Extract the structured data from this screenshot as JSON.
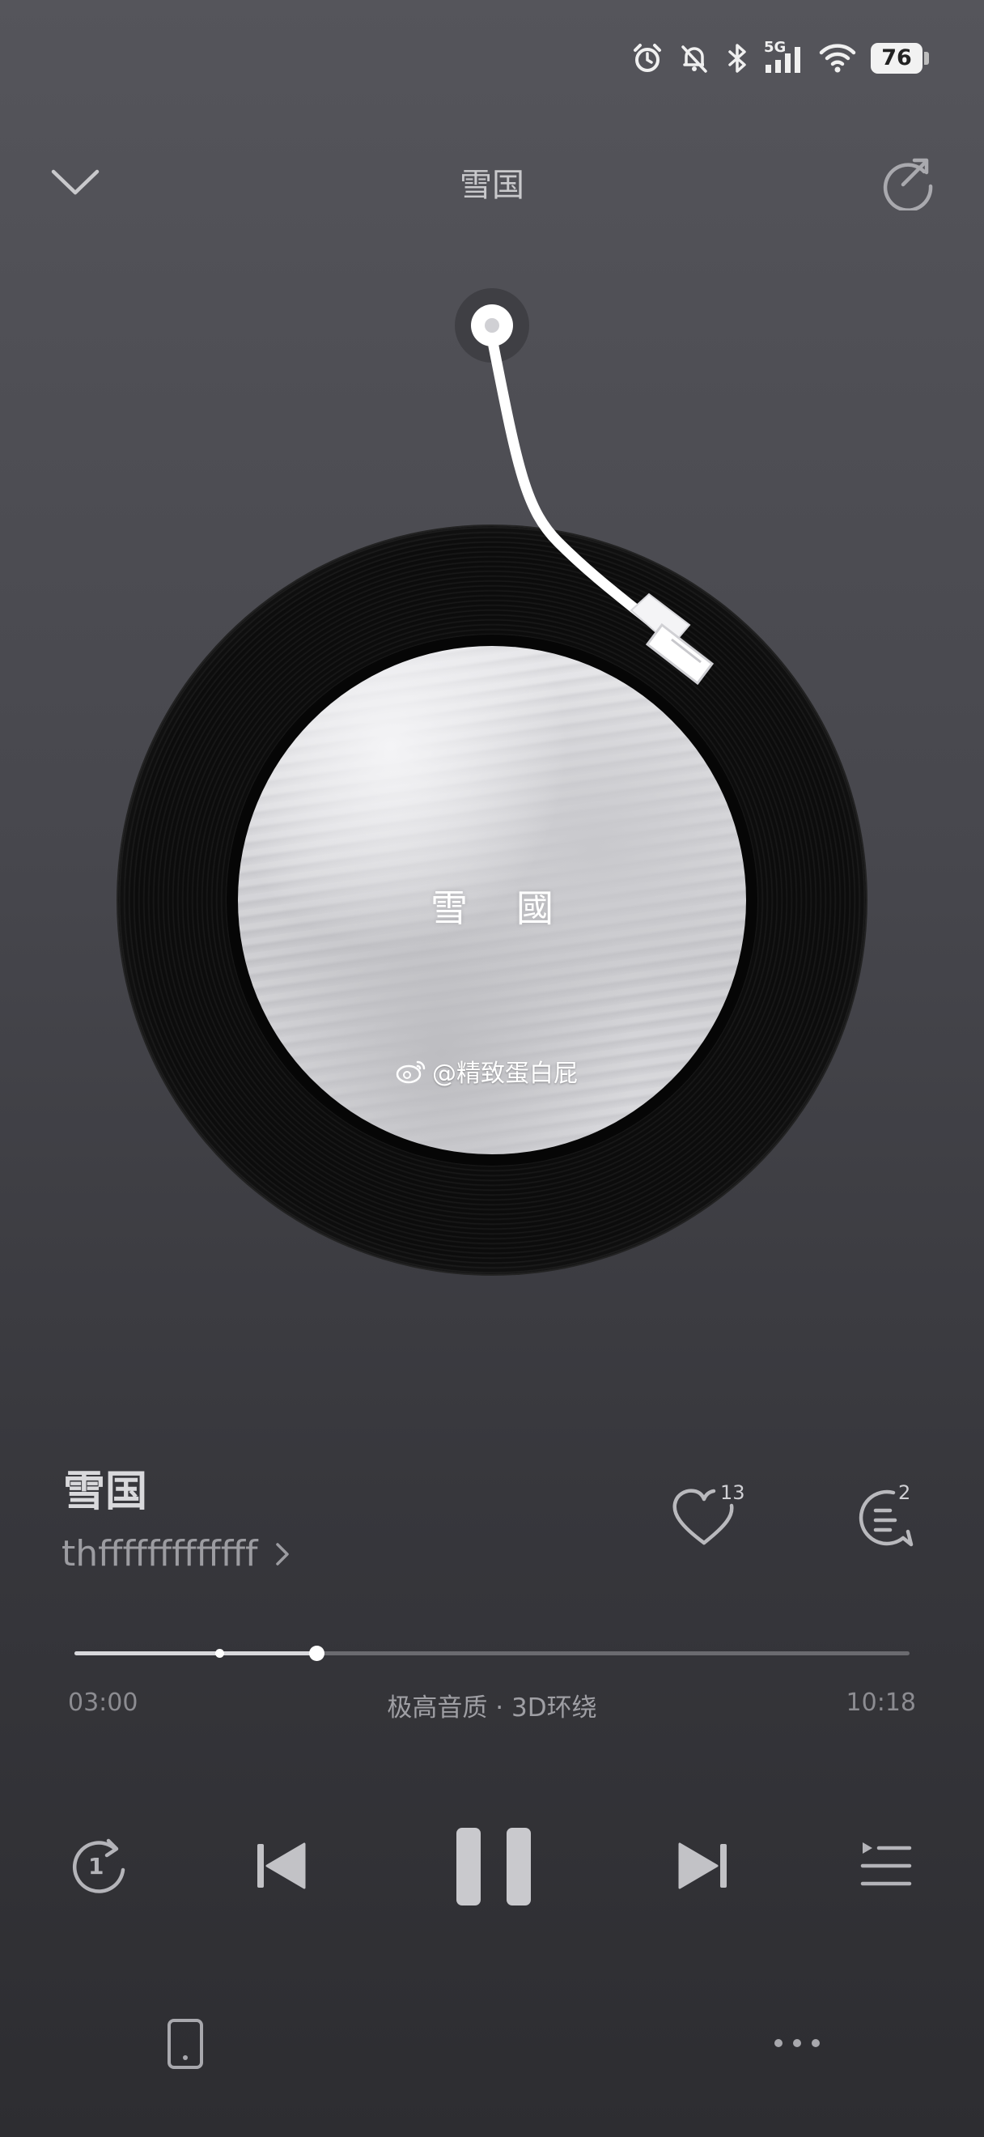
{
  "status_bar": {
    "battery": "76",
    "network": "5G",
    "icons": [
      "alarm-icon",
      "mute-icon",
      "bluetooth-icon",
      "signal-icon",
      "wifi-icon",
      "battery-icon"
    ]
  },
  "header": {
    "title": "雪国",
    "collapse_icon": "chevron-down-icon",
    "share_icon": "share-icon"
  },
  "album": {
    "cover_text": "雪國",
    "watermark": "@精致蛋白屁"
  },
  "song": {
    "title": "雪国",
    "artist": "thfffffffffffff",
    "likes": "13",
    "comments": "2"
  },
  "player": {
    "current_time": "03:00",
    "total_time": "10:18",
    "quality": "极高音质 · 3D环绕",
    "progress": 0.29,
    "buffered": 0.173,
    "repeat_mode": "1"
  },
  "colors": {
    "background_top": "#55555b",
    "background_bottom": "#2d2d31",
    "accent": "#d8d8dc"
  }
}
